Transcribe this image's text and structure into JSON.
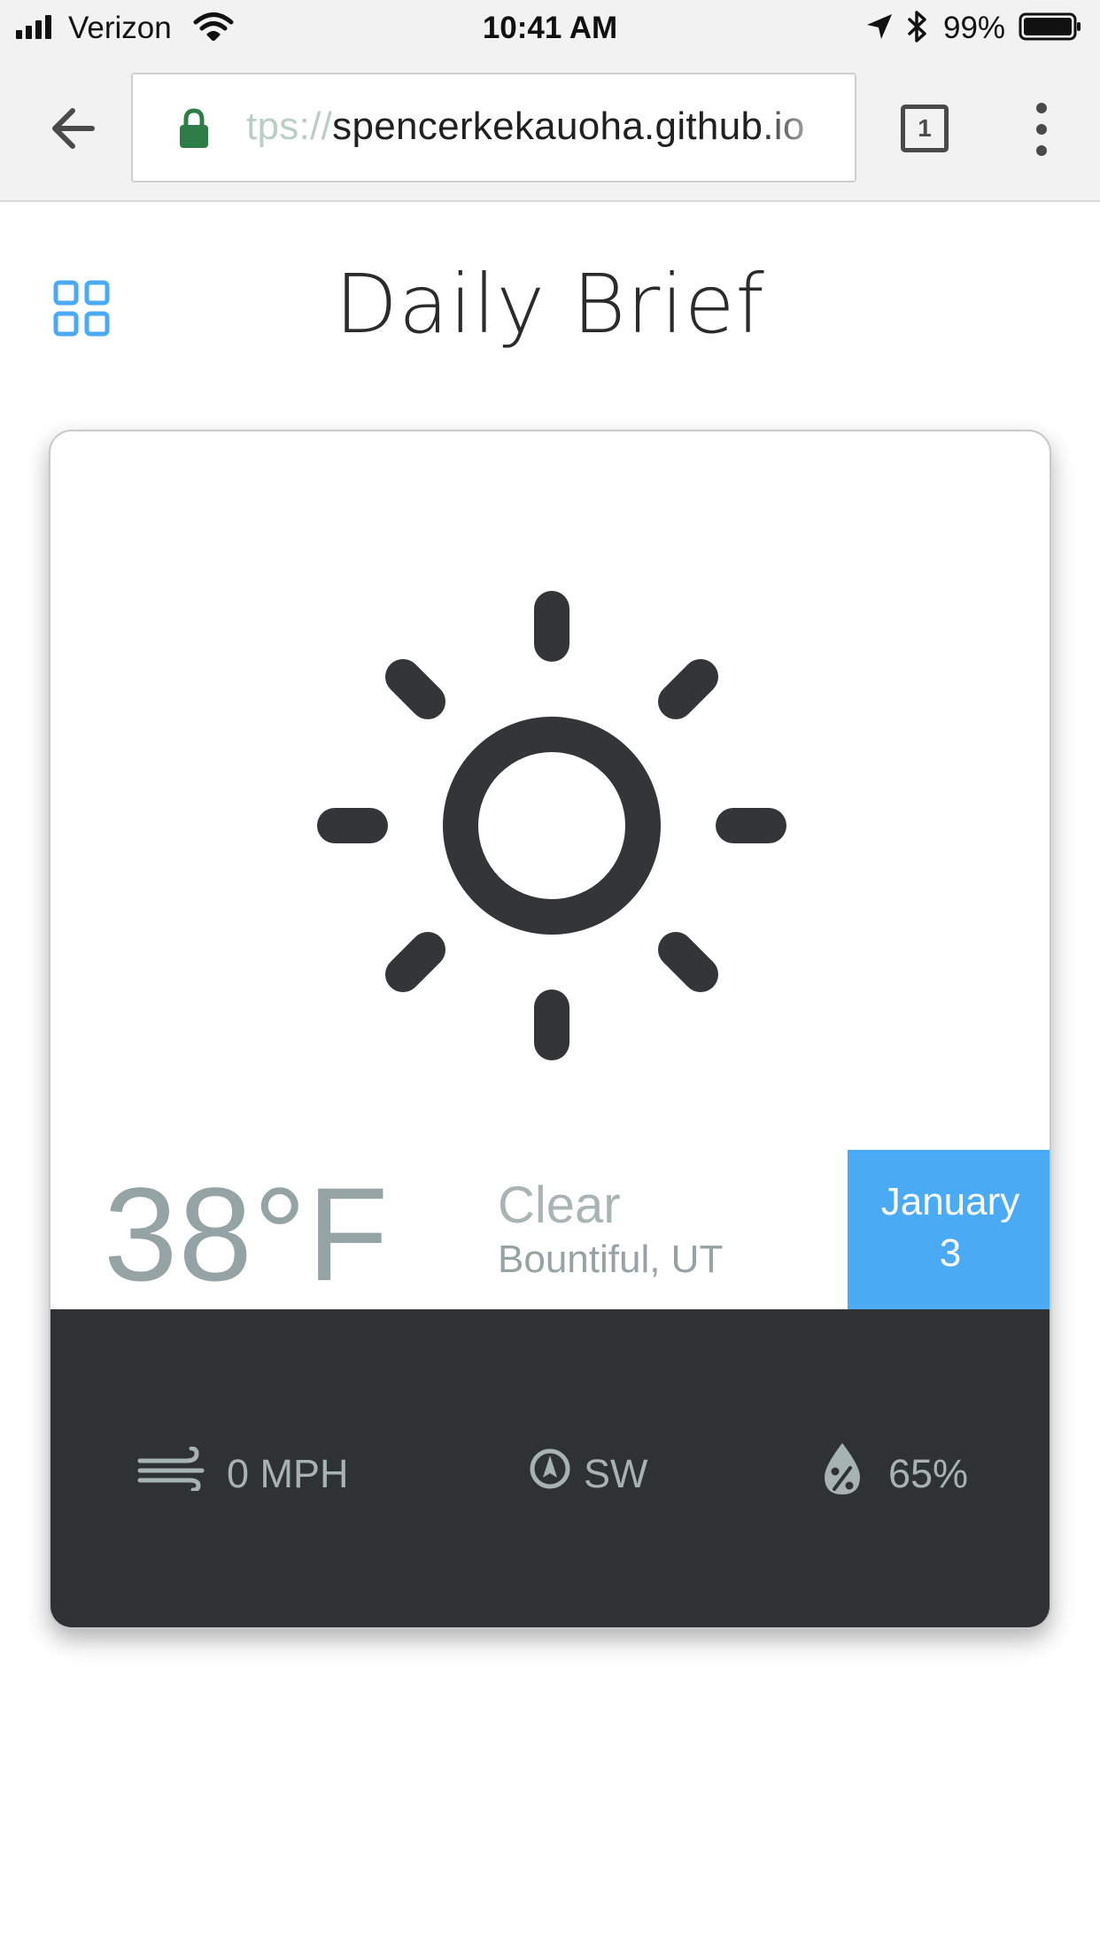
{
  "status_bar": {
    "carrier": "Verizon",
    "time": "10:41 AM",
    "battery": "99%"
  },
  "browser": {
    "url_scheme": "tps://",
    "url_host": "spencerkekauoha.github.io",
    "tab_count": "1"
  },
  "header": {
    "title": "Daily Brief"
  },
  "weather": {
    "temperature": "38°F",
    "condition": "Clear",
    "location": "Bountiful, UT",
    "date_month": "January",
    "date_day": "3",
    "wind_speed": "0 MPH",
    "wind_direction": "SW",
    "humidity": "65%"
  },
  "icons": {
    "menu": "grid-icon",
    "weather": "sun-icon",
    "wind": "wind-icon",
    "direction": "compass-icon",
    "humidity": "humidity-drop-icon"
  },
  "colors": {
    "accent": "#4aaaf4",
    "card_footer": "#2f3233",
    "muted_text": "#95a3a5",
    "sun": "#333637"
  }
}
